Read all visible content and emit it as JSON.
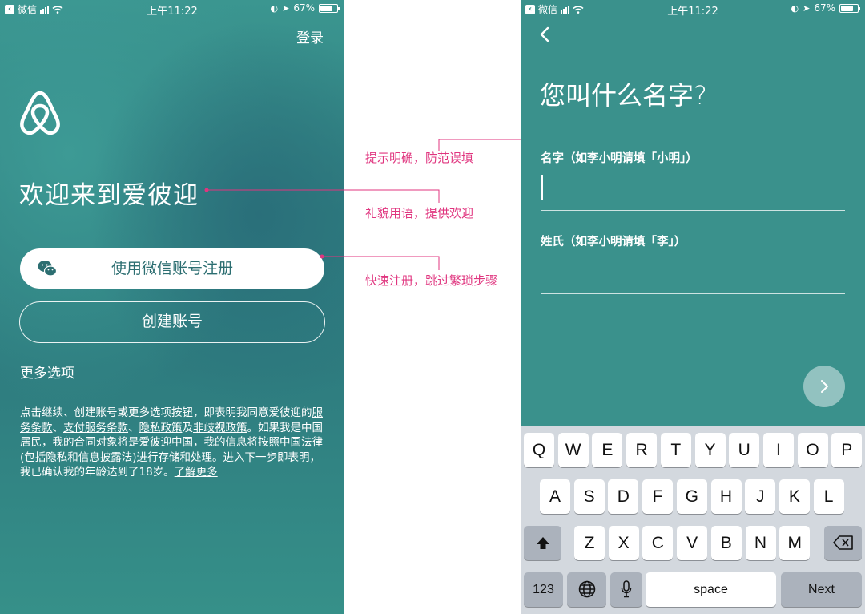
{
  "status_bar": {
    "back_app": "微信",
    "time": "上午11:22",
    "battery": "67%",
    "battery_level": 0.67
  },
  "welcome_screen": {
    "login_label": "登录",
    "welcome_text": "欢迎来到爱彼迎",
    "wechat_signup_label": "使用微信账号注册",
    "create_account_label": "创建账号",
    "more_options_label": "更多选项",
    "legal": {
      "p1": "点击继续、创建账号或更多选项按钮，即表明我同意爱彼迎的",
      "link_terms": "服务条款",
      "sep1": "、",
      "link_payment_terms": "支付服务条款",
      "sep2": "、",
      "link_privacy": "隐私政策",
      "sep3": "及",
      "link_nondiscrimination": "非歧视政策",
      "p2": "。如果我是中国居民，我的合同对象将是爱彼迎中国，我的信息将按照中国法律(包括隐私和信息披露法)进行存储和处理。进入下一步即表明，我已确认我的年龄达到了18岁。",
      "link_learn_more": "了解更多"
    }
  },
  "annotations": {
    "clear_prompt": "提示明确，防范误填",
    "polite_welcome": "礼貌用语，提供欢迎",
    "quick_signup": "快速注册，跳过繁琐步骤"
  },
  "name_screen": {
    "title": "您叫什么名字?",
    "first_name_label": "名字（如李小明请填「小明」）",
    "first_name_value": "",
    "last_name_label": "姓氏（如李小明请填「李」）",
    "last_name_value": ""
  },
  "keyboard": {
    "row1": [
      "Q",
      "W",
      "E",
      "R",
      "T",
      "Y",
      "U",
      "I",
      "O",
      "P"
    ],
    "row2": [
      "A",
      "S",
      "D",
      "F",
      "G",
      "H",
      "J",
      "K",
      "L"
    ],
    "row3": [
      "Z",
      "X",
      "C",
      "V",
      "B",
      "N",
      "M"
    ],
    "numbers_label": "123",
    "space_label": "space",
    "next_label": "Next"
  }
}
